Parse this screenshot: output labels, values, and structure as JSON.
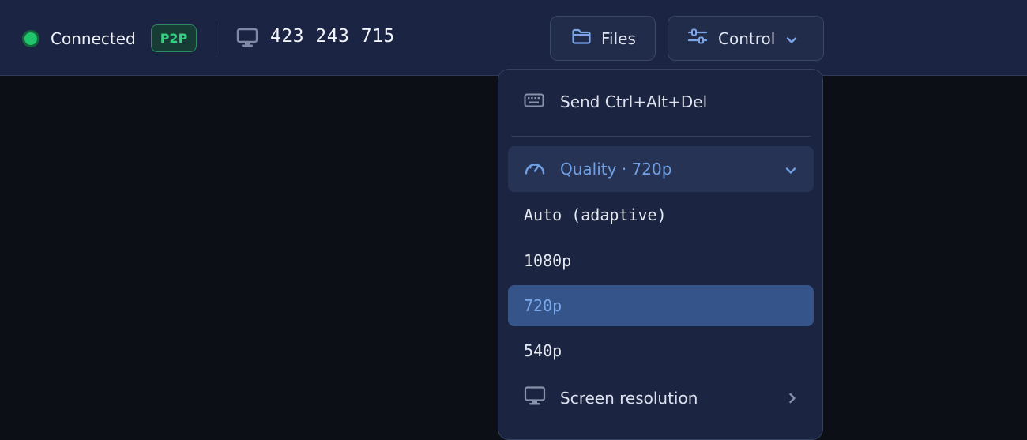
{
  "status": {
    "text": "Connected",
    "color": "#1fc46b"
  },
  "badge": {
    "text": "P2P"
  },
  "session": {
    "id": "423 243 715",
    "icon": "monitor-icon"
  },
  "toolbar": {
    "files": {
      "label": "Files",
      "icon": "folder-icon"
    },
    "control": {
      "label": "Control",
      "icon": "sliders-icon",
      "chevron": "chevron-down-icon"
    }
  },
  "menu": {
    "ctrl_alt_del": {
      "label": "Send Ctrl+Alt+Del",
      "icon": "keyboard-icon"
    },
    "quality": {
      "label": "Quality · 720p",
      "icon": "gauge-icon",
      "chevron": "chevron-down-icon"
    },
    "options": [
      "Auto (adaptive)",
      "1080p",
      "720p",
      "540p"
    ],
    "selected_option": "720p",
    "resolution": {
      "label": "Screen resolution",
      "icon": "monitor-icon",
      "chevron": "chevron-right-icon"
    }
  },
  "colors": {
    "accent": "#6f9fe4",
    "selected_bg": "#34548a",
    "topbar_bg": "#1b2442"
  }
}
